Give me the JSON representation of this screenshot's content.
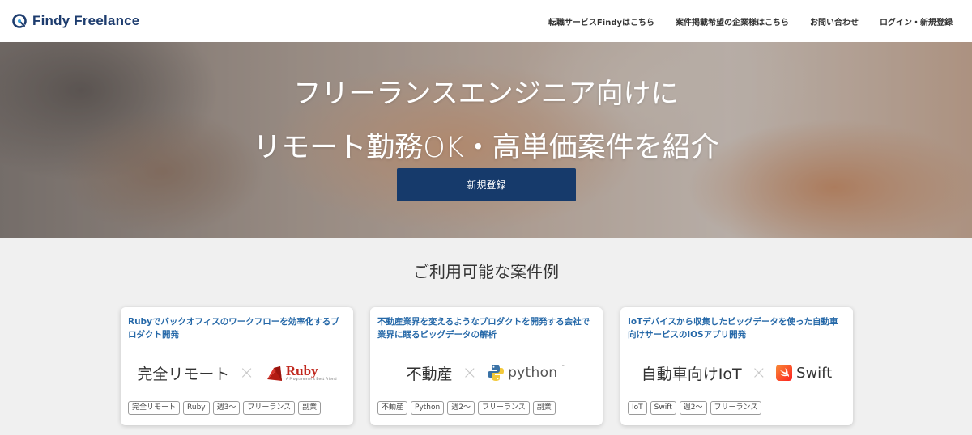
{
  "header": {
    "brand_word1": "Findy",
    "brand_word2": "Freelance",
    "nav": [
      "転職サービスFindyはこちら",
      "案件掲載希望の企業様はこちら",
      "お問い合わせ",
      "ログイン・新規登録"
    ]
  },
  "hero": {
    "line1": "フリーランスエンジニア向けに",
    "line2": "リモート勤務OK・高単価案件を紹介",
    "cta_label": "新規登録"
  },
  "section": {
    "title": "ご利用可能な案件例"
  },
  "cards": [
    {
      "title": "Rubyでバックオフィスのワークフローを効率化するプロダクト開発",
      "visual_text": "完全リモート",
      "times": "×",
      "tech_name": "Ruby",
      "tech_tagline": "A Programmer's Best Friend",
      "tags": [
        "完全リモート",
        "Ruby",
        "週3〜",
        "フリーランス",
        "副業"
      ]
    },
    {
      "title": "不動産業界を変えるようなプロダクトを開発する会社で業界に眠るビッグデータの解析",
      "visual_text": "不動産",
      "times": "×",
      "tech_name": "python",
      "tech_tagline": "™",
      "tags": [
        "不動産",
        "Python",
        "週2〜",
        "フリーランス",
        "副業"
      ]
    },
    {
      "title": "IoTデバイスから収集したビッグデータを使った自動車向けサービスのiOSアプリ開発",
      "visual_text": "自動車向けIoT",
      "times": "×",
      "tech_name": "Swift",
      "tech_tagline": "",
      "tags": [
        "IoT",
        "Swift",
        "週2〜",
        "フリーランス"
      ]
    }
  ],
  "colors": {
    "brand_navy": "#1d3c6e",
    "cta_navy": "#163a6b",
    "card_title_blue": "#2568a8",
    "ruby_red": "#c0271d"
  }
}
